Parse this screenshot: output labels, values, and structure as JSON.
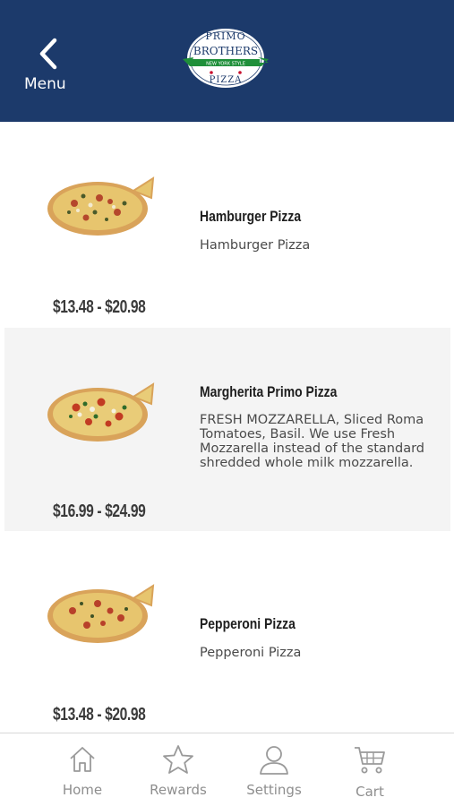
{
  "header": {
    "back_label": "Menu",
    "logo": {
      "top": "PRIMO",
      "middle": "BROTHERS",
      "banner": "NEW YORK STYLE",
      "bottom": "PIZZA"
    },
    "brand_color": "#1c3a6b",
    "banner_color": "#1f8f3a"
  },
  "items": [
    {
      "name": "Hamburger Pizza",
      "description": "Hamburger Pizza",
      "price": "$13.48 - $20.98"
    },
    {
      "name": "Margherita Primo Pizza",
      "description": "FRESH MOZZARELLA, Sliced Roma Tomatoes, Basil.  We use Fresh Mozzarella instead of the standard shredded whole milk mozzarella.",
      "price": "$16.99 - $24.99"
    },
    {
      "name": "Pepperoni Pizza",
      "description": "Pepperoni Pizza",
      "price": "$13.48 - $20.98"
    }
  ],
  "tabbar": {
    "home": {
      "label": "Home",
      "icon": "home-icon"
    },
    "rewards": {
      "label": "Rewards",
      "icon": "star-icon"
    },
    "settings": {
      "label": "Settings",
      "icon": "person-icon"
    },
    "cart": {
      "label": "Cart",
      "icon": "cart-icon"
    }
  }
}
